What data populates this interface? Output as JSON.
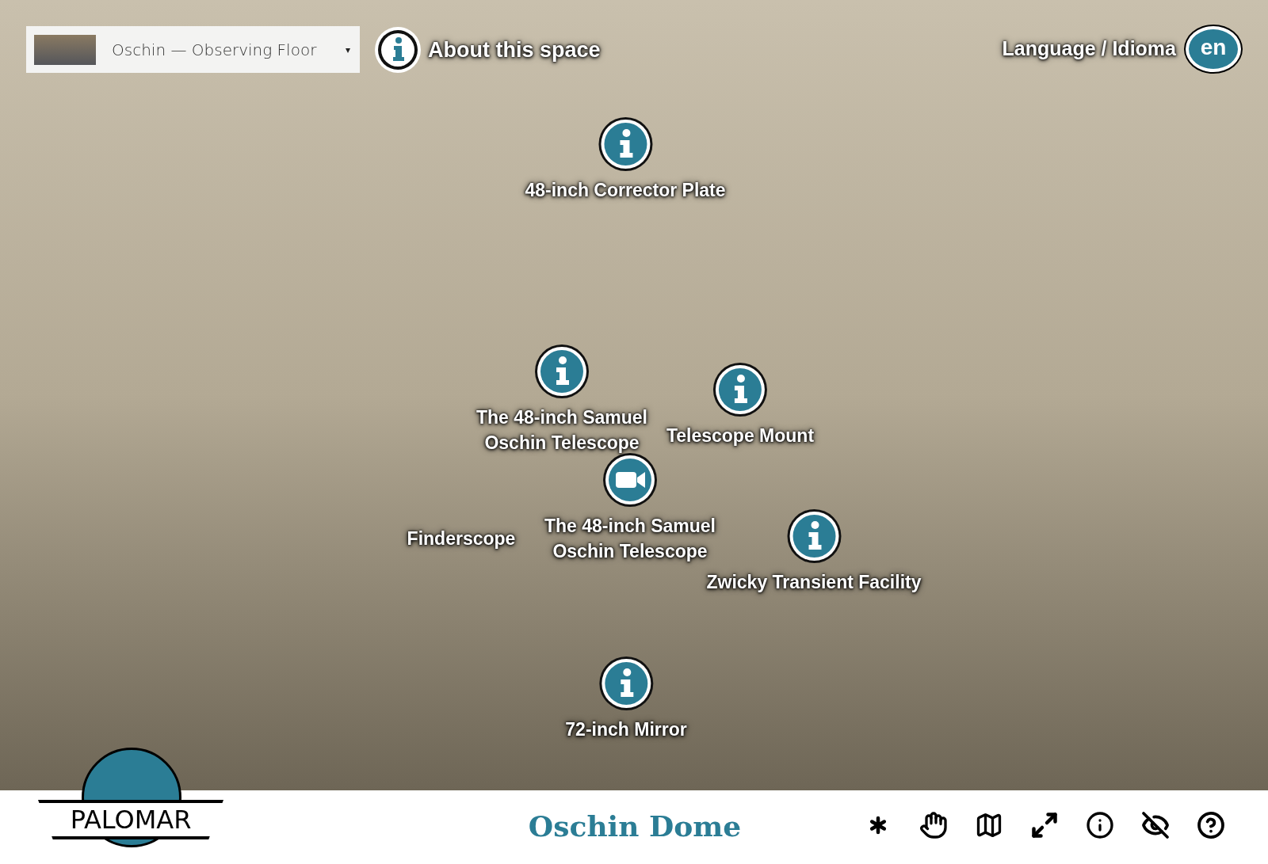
{
  "scene_selector": {
    "value": "Oschin — Observing Floor",
    "caret": "▾"
  },
  "about_button": {
    "label": "About this space"
  },
  "language_button": {
    "label": "Language / Idioma",
    "code": "en"
  },
  "hotspots": [
    {
      "kind": "info",
      "label": "48-inch Corrector Plate"
    },
    {
      "kind": "info",
      "label": "The 48-inch Samuel\nOschin Telescope"
    },
    {
      "kind": "info",
      "label": "Telescope Mount"
    },
    {
      "kind": "label",
      "label": "Finderscope"
    },
    {
      "kind": "video",
      "label": "The 48-inch Samuel\nOschin Telescope"
    },
    {
      "kind": "info",
      "label": "Zwicky Transient Facility"
    },
    {
      "kind": "info",
      "label": "72-inch Mirror"
    }
  ],
  "logo": {
    "text": "PALOMAR"
  },
  "footer": {
    "title": "Oschin Dome"
  }
}
